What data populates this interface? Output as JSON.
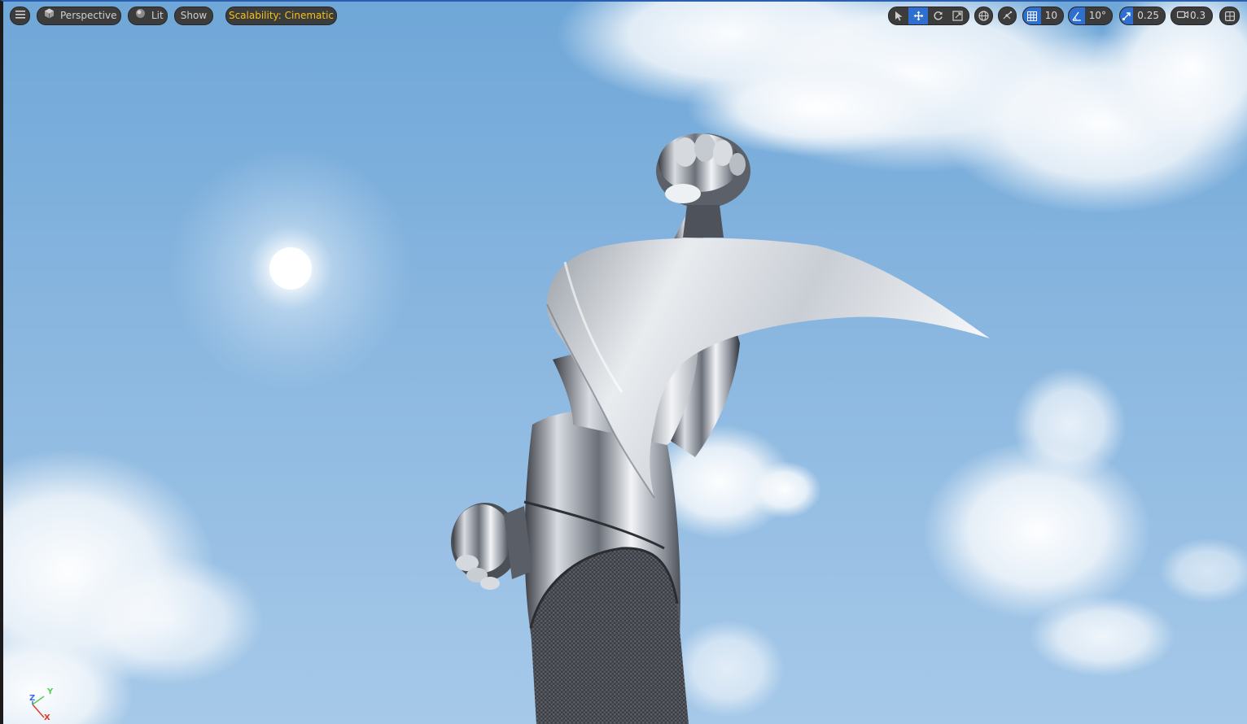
{
  "toolbar": {
    "menu_icon": "hamburger-menu-icon",
    "perspective_label": "Perspective",
    "lit_label": "Lit",
    "show_label": "Show",
    "scalability_label": "Scalability: Cinematic",
    "transform_tools": [
      "select-tool-icon",
      "translate-tool-icon",
      "rotate-tool-icon",
      "scale-tool-icon"
    ],
    "active_transform_tool": "translate-tool-icon",
    "world_local_icon": "globe-icon",
    "surface_snap_icon": "surface-snap-icon",
    "grid_snap_value": "10",
    "rotation_snap_value": "10°",
    "scale_snap_value": "0.25",
    "camera_speed_value": "0.3",
    "layout_icon": "viewport-layout-icon"
  },
  "axis": {
    "x": "X",
    "y": "Y",
    "z": "Z"
  },
  "colors": {
    "toolbar_bg": "#3c3c3c",
    "active_blue": "#2f6fcf",
    "scalability_text": "#f2c21a",
    "sky": "#8db9e2",
    "axis_x": "#e03a2a",
    "axis_y": "#4fd14f",
    "axis_z": "#3a6cf0"
  }
}
